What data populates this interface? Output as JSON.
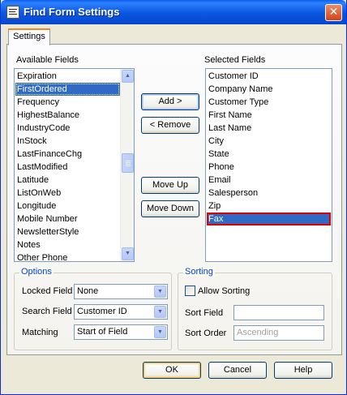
{
  "window": {
    "title": "Find Form Settings",
    "close_symbol": "✕"
  },
  "tabs": [
    {
      "label": "Settings",
      "active": true
    }
  ],
  "available": {
    "label": "Available Fields",
    "items": [
      "Expiration",
      "FirstOrdered",
      "Frequency",
      "HighestBalance",
      "IndustryCode",
      "InStock",
      "LastFinanceChg",
      "LastModified",
      "Latitude",
      "ListOnWeb",
      "Longitude",
      "Mobile Number",
      "NewsletterStyle",
      "Notes",
      "Other Phone"
    ],
    "selected": "FirstOrdered"
  },
  "selected_fields": {
    "label": "Selected Fields",
    "items": [
      "Customer ID",
      "Company Name",
      "Customer Type",
      "First Name",
      "Last Name",
      "City",
      "State",
      "Phone",
      "Email",
      "Salesperson",
      "Zip",
      "Fax"
    ],
    "selected": "Fax"
  },
  "buttons": {
    "add": "Add >",
    "remove": "< Remove",
    "move_up": "Move Up",
    "move_down": "Move Down",
    "ok": "OK",
    "cancel": "Cancel",
    "help": "Help"
  },
  "options": {
    "legend": "Options",
    "locked_field_label": "Locked Field",
    "locked_field_value": "None",
    "search_field_label": "Search Field",
    "search_field_value": "Customer ID",
    "matching_label": "Matching",
    "matching_value": "Start of Field"
  },
  "sorting": {
    "legend": "Sorting",
    "allow_sorting_label": "Allow Sorting",
    "allow_sorting_checked": false,
    "sort_field_label": "Sort Field",
    "sort_field_value": "",
    "sort_order_label": "Sort Order",
    "sort_order_value": "Ascending"
  },
  "colors": {
    "title_bar": "#0b56e0",
    "selection": "#316ac5",
    "highlight_border": "#e00000",
    "legend_text": "#0046d5"
  }
}
